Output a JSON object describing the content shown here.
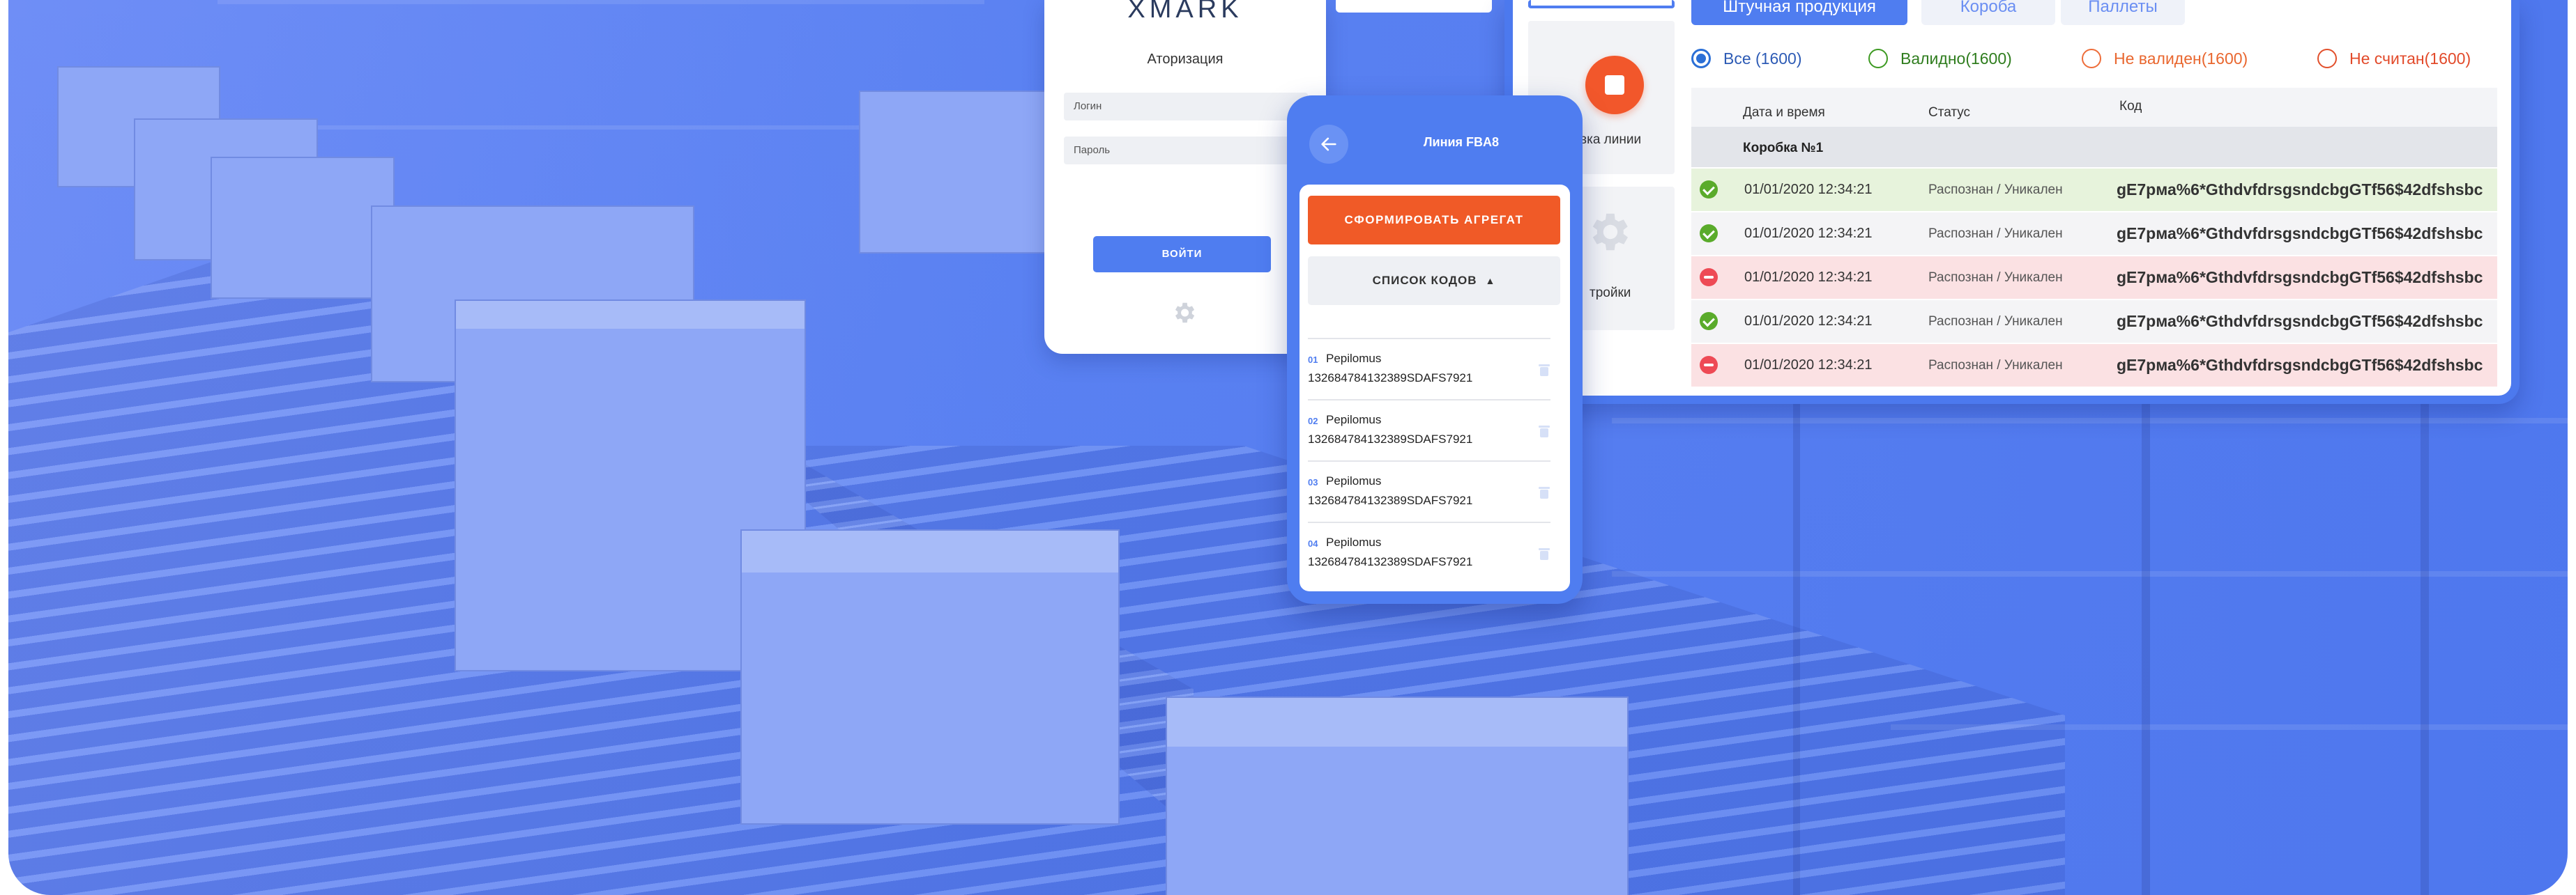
{
  "login": {
    "logo": "XMARK",
    "subtitle": "Аторизация",
    "login_field": "Логин",
    "password_field": "Пароль",
    "submit_label": "ВОЙТИ"
  },
  "desktop": {
    "side": {
      "stop_label": "вка линии",
      "settings_label": "тройки"
    },
    "tabs": [
      "Штучная продукция",
      "Короба",
      "Паллеты"
    ],
    "filters": {
      "all": "Все (1600)",
      "valid": "Валидно(1600)",
      "invalid": "Не валиден(1600)",
      "unread": "Не считан(1600)"
    },
    "table": {
      "headers": {
        "datetime": "Дата и время",
        "status": "Статус",
        "code": "Код"
      },
      "group": "Коробка №1",
      "rows": [
        {
          "state": "ok",
          "datetime": "01/01/2020 12:34:21",
          "status": "Распознан / Уникален",
          "code": "gE7pма%6*Gthdvfdrsgsndcbg​GTf56$42dfshsbc"
        },
        {
          "state": "ok",
          "datetime": "01/01/2020 12:34:21",
          "status": "Распознан / Уникален",
          "code": "gE7pма%6*Gthdvfdrsgsndcbg​GTf56$42dfshsbc"
        },
        {
          "state": "err",
          "datetime": "01/01/2020 12:34:21",
          "status": "Распознан / Уникален",
          "code": "gE7pма%6*Gthdvfdrsgsndcbg​GTf56$42dfshsbc"
        },
        {
          "state": "ok",
          "datetime": "01/01/2020 12:34:21",
          "status": "Распознан / Уникален",
          "code": "gE7pма%6*Gthdvfdrsgsndcbg​GTf56$42dfshsbc"
        },
        {
          "state": "err",
          "datetime": "01/01/2020 12:34:21",
          "status": "Распознан / Уникален",
          "code": "gE7pма%6*Gthdvfdrsgsndcbg​GTf56$42dfshsbc"
        }
      ]
    }
  },
  "mobile": {
    "title": "Линия FBA8",
    "aggregate_button": "СФОРМИРОВАТЬ АГРЕГАТ",
    "codes_toggle": "СПИСОК КОДОВ",
    "items": [
      {
        "num": "01",
        "name": "Pepilomus",
        "code": "132684784132389SDAFS7921"
      },
      {
        "num": "02",
        "name": "Pepilomus",
        "code": "132684784132389SDAFS7921"
      },
      {
        "num": "03",
        "name": "Pepilomus",
        "code": "132684784132389SDAFS7921"
      },
      {
        "num": "04",
        "name": "Pepilomus",
        "code": "132684784132389SDAFS7921"
      }
    ]
  },
  "colors": {
    "brand_blue": "#4f7df0",
    "accent_orange": "#f05a27",
    "ok_green": "#5aab2b",
    "error_red": "#ee4a55"
  },
  "icons": [
    "back-arrow-icon",
    "chevron-up-icon",
    "trash-icon",
    "gear-icon",
    "stop-icon",
    "check-icon",
    "minus-icon"
  ]
}
